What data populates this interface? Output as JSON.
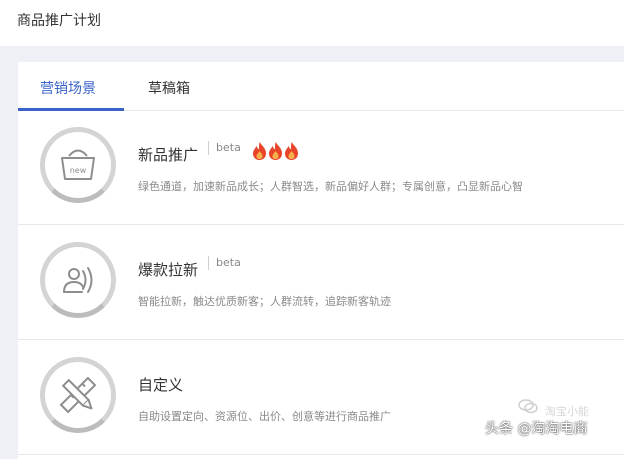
{
  "header": {
    "title": "商品推广计划"
  },
  "tabs": [
    {
      "label": "营销场景",
      "active": true
    },
    {
      "label": "草稿箱",
      "active": false
    }
  ],
  "cards": [
    {
      "title": "新品推广",
      "badge": "beta",
      "hot_count": 3,
      "icon": "new-bag-icon",
      "icon_text": "new",
      "description": "绿色通道，加速新品成长；人群智选，新品偏好人群；专属创意，凸显新品心智"
    },
    {
      "title": "爆款拉新",
      "badge": "beta",
      "icon": "user-wave-icon",
      "description": "智能拉新，触达优质新客；人群流转，追踪新客轨迹"
    },
    {
      "title": "自定义",
      "icon": "pencil-ruler-icon",
      "description": "自助设置定向、资源位、出价、创意等进行商品推广"
    }
  ],
  "watermark": {
    "text": "头条 @淘淘电商",
    "faint_text": "淘宝小能"
  },
  "colors": {
    "accent": "#3a63c8",
    "flame": "#e8442a"
  }
}
